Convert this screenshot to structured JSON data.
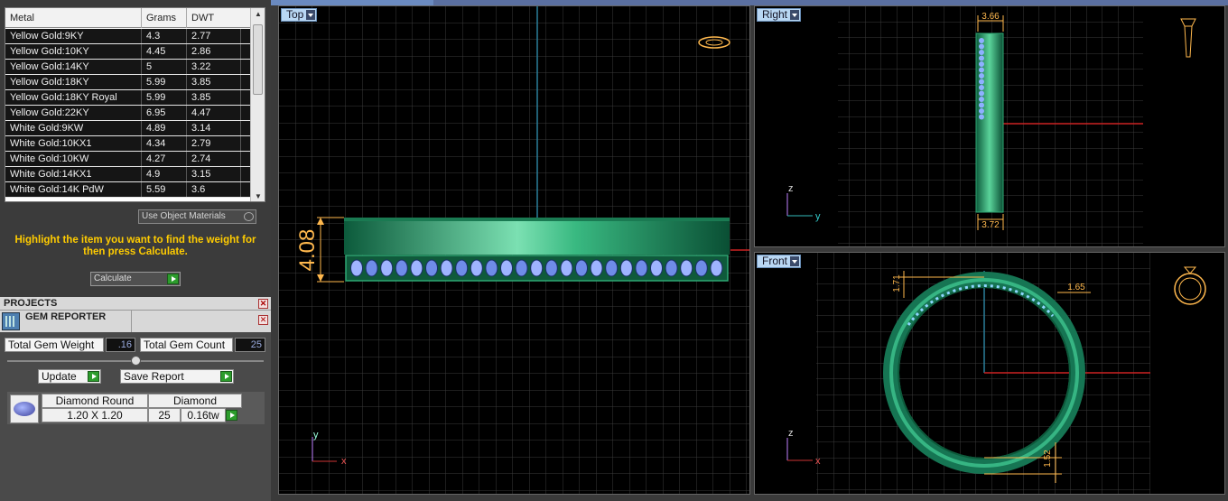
{
  "metal_table": {
    "headers": {
      "metal": "Metal",
      "grams": "Grams",
      "dwt": "DWT"
    },
    "rows": [
      {
        "metal": "Yellow Gold:9KY",
        "grams": "4.3",
        "dwt": "2.77"
      },
      {
        "metal": "Yellow Gold:10KY",
        "grams": "4.45",
        "dwt": "2.86"
      },
      {
        "metal": "Yellow Gold:14KY",
        "grams": "5",
        "dwt": "3.22"
      },
      {
        "metal": "Yellow Gold:18KY",
        "grams": "5.99",
        "dwt": "3.85"
      },
      {
        "metal": "Yellow Gold:18KY Royal",
        "grams": "5.99",
        "dwt": "3.85"
      },
      {
        "metal": "Yellow Gold:22KY",
        "grams": "6.95",
        "dwt": "4.47"
      },
      {
        "metal": "White Gold:9KW",
        "grams": "4.89",
        "dwt": "3.14"
      },
      {
        "metal": "White Gold:10KX1",
        "grams": "4.34",
        "dwt": "2.79"
      },
      {
        "metal": "White Gold:10KW",
        "grams": "4.27",
        "dwt": "2.74"
      },
      {
        "metal": "White Gold:14KX1",
        "grams": "4.9",
        "dwt": "3.15"
      },
      {
        "metal": "White Gold:14K PdW",
        "grams": "5.59",
        "dwt": "3.6"
      }
    ]
  },
  "use_object_materials": "Use Object Materials",
  "hint": "Highlight the item you want to find the weight for then press Calculate.",
  "calculate_label": "Calculate",
  "projects_label": "PROJECTS",
  "gem_reporter": {
    "title": "GEM REPORTER",
    "total_weight_label": "Total Gem Weight",
    "total_weight_value": ".16",
    "total_count_label": "Total Gem Count",
    "total_count_value": "25",
    "update_label": "Update",
    "save_report_label": "Save Report",
    "gem": {
      "cut": "Diamond Round",
      "size": "1.20 X 1.20",
      "material": "Diamond",
      "count": "25",
      "weight": "0.16tw"
    }
  },
  "viewports": {
    "top": {
      "label": "Top",
      "dim_height": "4.08",
      "axis_y": "y",
      "axis_x": "x"
    },
    "right": {
      "label": "Right",
      "dim_top": "3.66",
      "dim_bottom": "3.72",
      "axis_z": "z",
      "axis_y": "y"
    },
    "front": {
      "label": "Front",
      "dim_left": "1.71",
      "dim_right": "1.65",
      "dim_bottom": "1.52",
      "axis_z": "z",
      "axis_x": "x"
    }
  },
  "colors": {
    "accent_yellow": "#ffcc00",
    "ring_green": "#1f8f63",
    "dim_orange": "#ffb84d",
    "grid": "#3a3a3a"
  }
}
